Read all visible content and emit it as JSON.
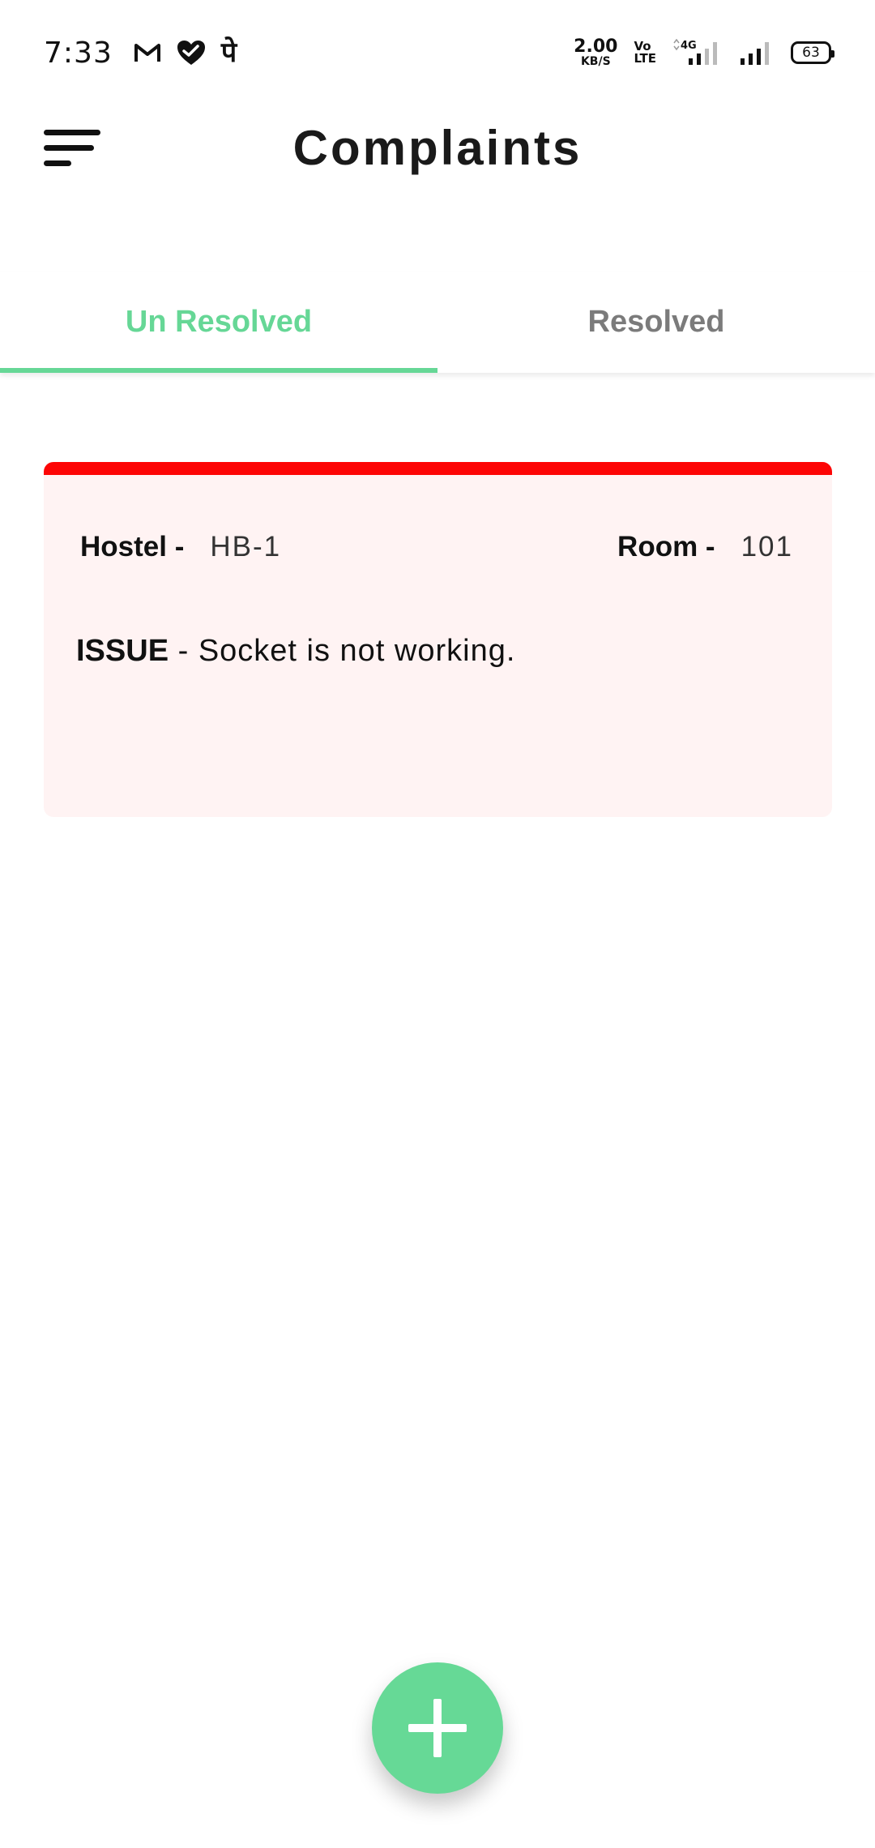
{
  "status_bar": {
    "time": "7:33",
    "notification_icons": [
      "gmail-icon",
      "health-heart-icon",
      "phonepe-icon"
    ],
    "phonepe_glyph": "पे",
    "net_speed_value": "2.00",
    "net_speed_unit": "KB/S",
    "volte_top": "Vo",
    "volte_bottom": "LTE",
    "network_type": "4G",
    "battery": "63"
  },
  "app_bar": {
    "title": "Complaints",
    "menu_icon": "hamburger-menu-icon"
  },
  "tabs": [
    {
      "label": "Un Resolved",
      "active": true
    },
    {
      "label": "Resolved",
      "active": false
    }
  ],
  "complaints": [
    {
      "hostel_label": "Hostel -",
      "hostel_value": "HB-1",
      "room_label": "Room -",
      "room_value": "101",
      "issue_label": "ISSUE",
      "issue_text": "- Socket is not working.",
      "status_color": "#fd0505"
    }
  ],
  "fab": {
    "icon": "plus-icon"
  },
  "colors": {
    "accent": "#66d796",
    "card_bg": "#fff3f3",
    "unresolved_bar": "#fd0505",
    "inactive_tab": "#7b7b7b"
  }
}
